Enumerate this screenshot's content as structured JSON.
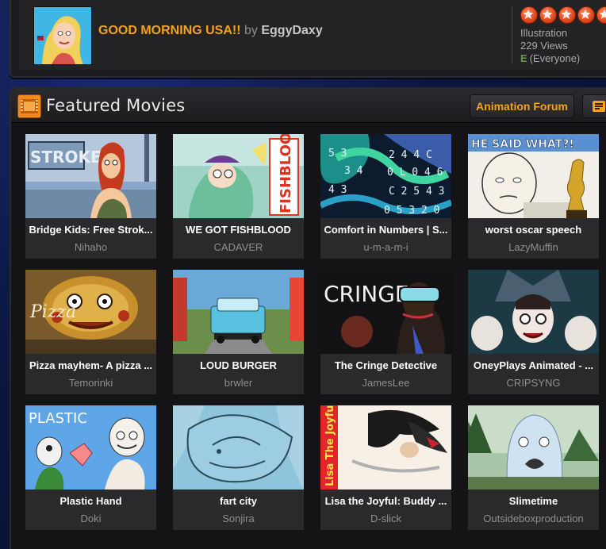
{
  "featured_art": {
    "title": "GOOD MORNING USA!!",
    "by": "by",
    "author": "EggyDaxy",
    "stars": 5,
    "category": "Illustration",
    "views": "229 Views",
    "rating_letter": "E",
    "rating_label": "(Everyone)"
  },
  "featured_movies": {
    "header_title": "Featured Movies",
    "forum_button": "Animation Forum",
    "items": [
      {
        "title": "Bridge Kids: Free Strok...",
        "author": "Nihaho"
      },
      {
        "title": "WE GOT FISHBLOOD",
        "author": "CADAVER"
      },
      {
        "title": "Comfort in Numbers | S...",
        "author": "u-m-a-m-i"
      },
      {
        "title": "worst oscar speech",
        "author": "LazyMuffin"
      },
      {
        "title": "Pizza mayhem- A pizza ...",
        "author": "Temorinki"
      },
      {
        "title": "LOUD BURGER",
        "author": "brwler"
      },
      {
        "title": "The Cringe Detective",
        "author": "JamesLee"
      },
      {
        "title": "OneyPlays Animated - ...",
        "author": "CRIPSYNG"
      },
      {
        "title": "Plastic Hand",
        "author": "Doki"
      },
      {
        "title": "fart city",
        "author": "Sonjira"
      },
      {
        "title": "Lisa the Joyful: Buddy ...",
        "author": "D-slick"
      },
      {
        "title": "Slimetime",
        "author": "Outsideboxproduction"
      }
    ],
    "thumb_texts": {
      "strok": "STROKE",
      "fishblood": "FISHBLOOD",
      "said_what": "HE SAID WHAT?!",
      "pizza": "Pizza",
      "cringe": "CRINGE",
      "plastic": "PLASTIC",
      "lisa": "Lisa The Joyful"
    }
  },
  "colors": {
    "accent_orange": "#f7a21b",
    "rating_green": "#4caf2f",
    "star_red": "#e3461c"
  }
}
